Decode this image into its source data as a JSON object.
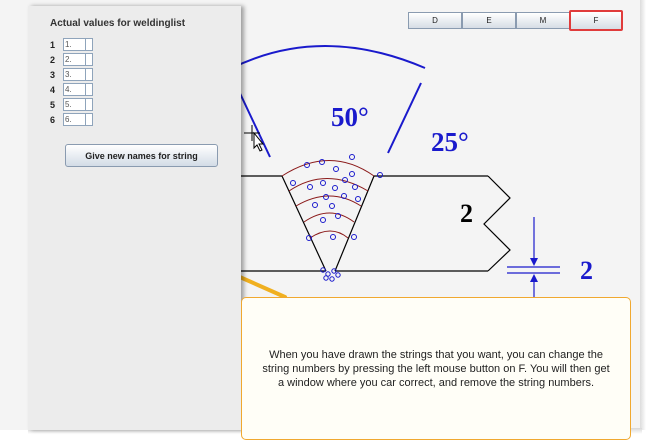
{
  "panel": {
    "title": "Actual values for weldinglist",
    "rows": [
      {
        "num": "1",
        "value": "1."
      },
      {
        "num": "2",
        "value": "2."
      },
      {
        "num": "3",
        "value": "3."
      },
      {
        "num": "4",
        "value": "4."
      },
      {
        "num": "5",
        "value": "5."
      },
      {
        "num": "6",
        "value": "6."
      }
    ],
    "button_label": "Give new names for string"
  },
  "toolbar": {
    "buttons": [
      "D",
      "E",
      "M",
      "F"
    ],
    "highlighted": "F"
  },
  "drawing": {
    "angle_large": "50°",
    "angle_small": "25°",
    "thickness_label": "2",
    "gap_label": "2",
    "colors": {
      "dimension": "#1a1acc",
      "weld_string": "#8b1a1a",
      "outline": "#000000",
      "callout": "#f0b020"
    }
  },
  "tooltip": {
    "text": "When you have drawn the strings that you want, you can change the string numbers by pressing the left mouse button on F. You will then get a window where you car correct, and remove the string numbers."
  }
}
